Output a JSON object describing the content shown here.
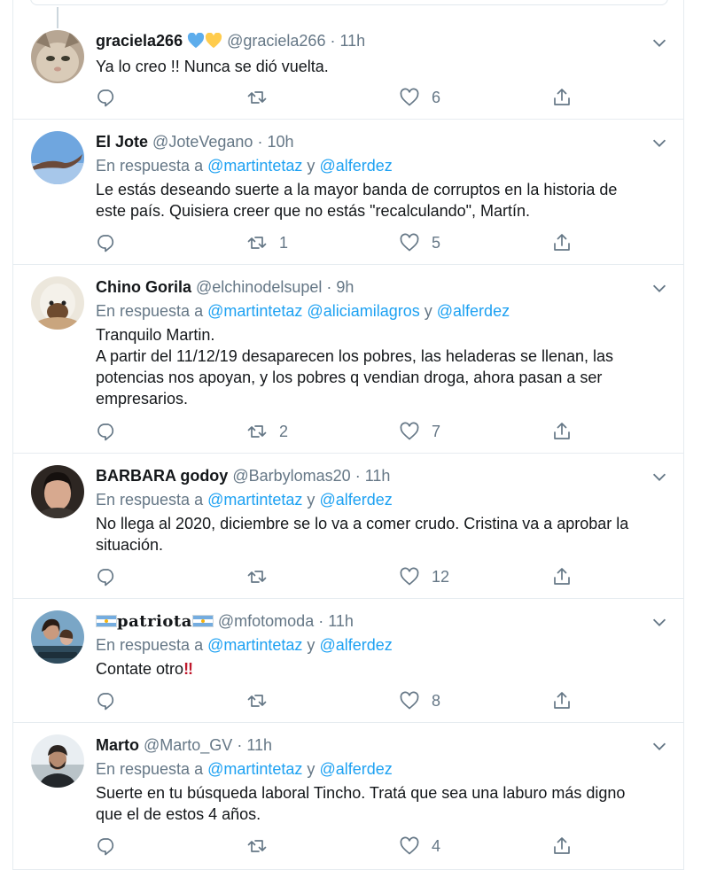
{
  "tweets": [
    {
      "name": "graciela266",
      "handle": "@graciela266",
      "sep": "·",
      "time": "11h",
      "reply_prefix": "",
      "reply_to": [],
      "text_lines": [
        "Ya lo creo !! Nunca se dió vuelta."
      ],
      "replies": "",
      "retweets": "",
      "likes": "6"
    },
    {
      "name": "El Jote",
      "handle": "@JoteVegano",
      "sep": "·",
      "time": "10h",
      "reply_prefix": "En respuesta a",
      "reply_to": [
        "@martintetaz",
        "y",
        "@alferdez"
      ],
      "text_lines": [
        "Le estás deseando suerte a la mayor banda de corruptos en la historia de",
        "este país. Quisiera creer que no estás \"recalculando\", Martín."
      ],
      "replies": "",
      "retweets": "1",
      "likes": "5"
    },
    {
      "name": "Chino Gorila",
      "handle": "@elchinodelsupel",
      "sep": "·",
      "time": "9h",
      "reply_prefix": "En respuesta a",
      "reply_to": [
        "@martintetaz",
        "@aliciamilagros",
        "y",
        "@alferdez"
      ],
      "text_lines": [
        "Tranquilo Martin.",
        "A partir del 11/12/19 desaparecen los pobres, las heladeras se llenan, las",
        "potencias nos apoyan, y los pobres q vendian droga, ahora pasan a ser",
        "empresarios."
      ],
      "replies": "",
      "retweets": "2",
      "likes": "7"
    },
    {
      "name": "BARBARA godoy",
      "handle": "@Barbylomas20",
      "sep": "·",
      "time": "11h",
      "reply_prefix": "En respuesta a",
      "reply_to": [
        "@martintetaz",
        "y",
        "@alferdez"
      ],
      "text_lines": [
        "No llega al 2020, diciembre se lo va a comer crudo. Cristina va a aprobar la",
        "situación."
      ],
      "replies": "",
      "retweets": "",
      "likes": "12"
    },
    {
      "name": "patriota",
      "handle": "@mfotomoda",
      "sep": "·",
      "time": "11h",
      "reply_prefix": "En respuesta a",
      "reply_to": [
        "@martintetaz",
        "y",
        "@alferdez"
      ],
      "text_lines": [
        "Contate otro"
      ],
      "text_suffix": "‼",
      "replies": "",
      "retweets": "",
      "likes": "8"
    },
    {
      "name": "Marto",
      "handle": "@Marto_GV",
      "sep": "·",
      "time": "11h",
      "reply_prefix": "En respuesta a",
      "reply_to": [
        "@martintetaz",
        "y",
        "@alferdez"
      ],
      "text_lines": [
        "Suerte en tu búsqueda laboral Tincho. Tratá que sea una laburo más digno",
        "que el de estos 4 años."
      ],
      "replies": "",
      "retweets": "",
      "likes": "4"
    }
  ],
  "colors": {
    "link": "#1da1f2",
    "secondary": "#657786",
    "primary": "#14171a",
    "divider": "#e6ecf0"
  },
  "icons": {
    "reply": "reply-icon",
    "retweet": "retweet-icon",
    "like": "heart-icon",
    "share": "share-icon",
    "more": "chevron-down-icon"
  }
}
